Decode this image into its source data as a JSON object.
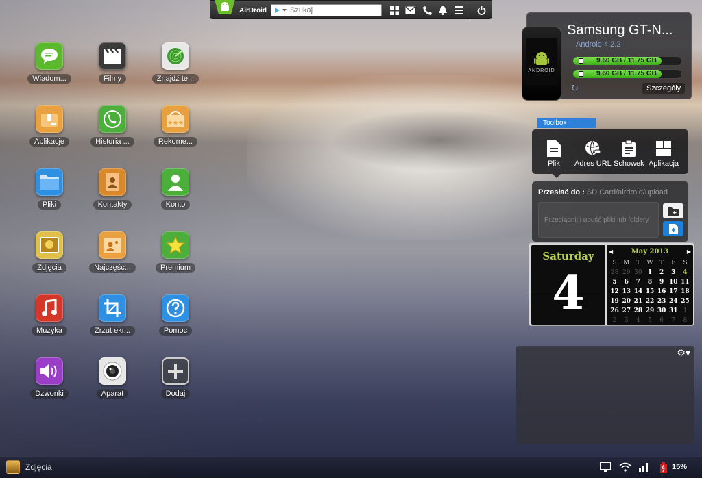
{
  "topbar": {
    "brand": "AirDroid",
    "search_placeholder": "Szukaj",
    "icons": [
      "apps-grid-icon",
      "mail-icon",
      "phone-icon",
      "notification-bell-icon",
      "menu-icon",
      "power-icon"
    ]
  },
  "apps": [
    {
      "label": "Wiadom...",
      "icon": "messages-icon",
      "color": "#5cb82c"
    },
    {
      "label": "Filmy",
      "icon": "film-clapper-icon",
      "color": "#3a3a3a"
    },
    {
      "label": "Znajdź te...",
      "icon": "radar-icon",
      "color": "#e8e8e8"
    },
    {
      "label": "Aplikacje",
      "icon": "package-icon",
      "color": "#e8a13e"
    },
    {
      "label": "Historia ...",
      "icon": "phone-history-icon",
      "color": "#4caf3c"
    },
    {
      "label": "Rekome...",
      "icon": "shop-bag-icon",
      "color": "#e8a13e"
    },
    {
      "label": "Pliki",
      "icon": "folder-icon",
      "color": "#2f8fe0"
    },
    {
      "label": "Kontakty",
      "icon": "contacts-book-icon",
      "color": "#d9892a"
    },
    {
      "label": "Konto",
      "icon": "user-account-icon",
      "color": "#4caf3c"
    },
    {
      "label": "Zdjęcia",
      "icon": "photo-icon",
      "color": "#e0c048"
    },
    {
      "label": "Najczęśc...",
      "icon": "frequent-contacts-icon",
      "color": "#e8a13e"
    },
    {
      "label": "Premium",
      "icon": "star-icon",
      "color": "#4caf3c"
    },
    {
      "label": "Muzyka",
      "icon": "music-note-icon",
      "color": "#d4372a"
    },
    {
      "label": "Zrzut ekr...",
      "icon": "crop-screenshot-icon",
      "color": "#2f8fe0"
    },
    {
      "label": "Pomoc",
      "icon": "help-question-icon",
      "color": "#2f8fe0"
    },
    {
      "label": "Dzwonki",
      "icon": "speaker-volume-icon",
      "color": "#9a3ec8"
    },
    {
      "label": "Aparat",
      "icon": "camera-lens-icon",
      "color": "#e6e6e6"
    },
    {
      "label": "Dodaj",
      "icon": "add-plus-icon",
      "color": "#555555"
    }
  ],
  "device": {
    "name": "Samsung GT-N...",
    "os": "Android 4.2.2",
    "storage1": {
      "text": "9.60 GB / 11.75 GB",
      "fraction": 0.817
    },
    "storage2": {
      "text": "9.60 GB / 11.75 GB",
      "fraction": 0.817
    },
    "details_label": "Szczegóły",
    "phone_label": "ANDROID"
  },
  "toolbox": {
    "tab": "Toolbox",
    "tools": [
      {
        "label": "Plik",
        "icon": "file-icon"
      },
      {
        "label": "Adres URL",
        "icon": "globe-link-icon"
      },
      {
        "label": "Schowek",
        "icon": "clipboard-icon"
      },
      {
        "label": "Aplikacja",
        "icon": "app-package-icon"
      }
    ]
  },
  "upload": {
    "send_to_label": "Przesłać do :",
    "path": "SD Card/airdroid/upload",
    "drop_hint": "Przeciągnij i upuść pliki lub foldery"
  },
  "calendar": {
    "day_name": "Saturday",
    "day_number": "4",
    "month_title": "May 2013",
    "weekday_headers": [
      "S",
      "M",
      "T",
      "W",
      "T",
      "F",
      "S"
    ],
    "cells": [
      {
        "d": "28",
        "t": "dim"
      },
      {
        "d": "29",
        "t": "dim"
      },
      {
        "d": "30",
        "t": "dim"
      },
      {
        "d": "1",
        "t": ""
      },
      {
        "d": "2",
        "t": ""
      },
      {
        "d": "3",
        "t": ""
      },
      {
        "d": "4",
        "t": "sel"
      },
      {
        "d": "5",
        "t": ""
      },
      {
        "d": "6",
        "t": ""
      },
      {
        "d": "7",
        "t": ""
      },
      {
        "d": "8",
        "t": ""
      },
      {
        "d": "9",
        "t": ""
      },
      {
        "d": "10",
        "t": ""
      },
      {
        "d": "11",
        "t": ""
      },
      {
        "d": "12",
        "t": ""
      },
      {
        "d": "13",
        "t": ""
      },
      {
        "d": "14",
        "t": ""
      },
      {
        "d": "15",
        "t": ""
      },
      {
        "d": "16",
        "t": ""
      },
      {
        "d": "17",
        "t": ""
      },
      {
        "d": "18",
        "t": ""
      },
      {
        "d": "19",
        "t": ""
      },
      {
        "d": "20",
        "t": ""
      },
      {
        "d": "21",
        "t": ""
      },
      {
        "d": "22",
        "t": ""
      },
      {
        "d": "23",
        "t": ""
      },
      {
        "d": "24",
        "t": ""
      },
      {
        "d": "25",
        "t": ""
      },
      {
        "d": "26",
        "t": ""
      },
      {
        "d": "27",
        "t": ""
      },
      {
        "d": "28",
        "t": ""
      },
      {
        "d": "29",
        "t": ""
      },
      {
        "d": "30",
        "t": ""
      },
      {
        "d": "31",
        "t": ""
      },
      {
        "d": "1",
        "t": "dim"
      },
      {
        "d": "2",
        "t": "dim"
      },
      {
        "d": "3",
        "t": "dim"
      },
      {
        "d": "4",
        "t": "dim"
      },
      {
        "d": "5",
        "t": "dim"
      },
      {
        "d": "6",
        "t": "dim"
      },
      {
        "d": "7",
        "t": "dim"
      },
      {
        "d": "8",
        "t": "dim"
      }
    ]
  },
  "taskbar": {
    "active_app": "Zdjęcia",
    "tray_icons": [
      "screen-mirror-icon",
      "wifi-icon",
      "signal-bars-icon",
      "battery-charging-icon"
    ],
    "battery_percent": "15%"
  }
}
